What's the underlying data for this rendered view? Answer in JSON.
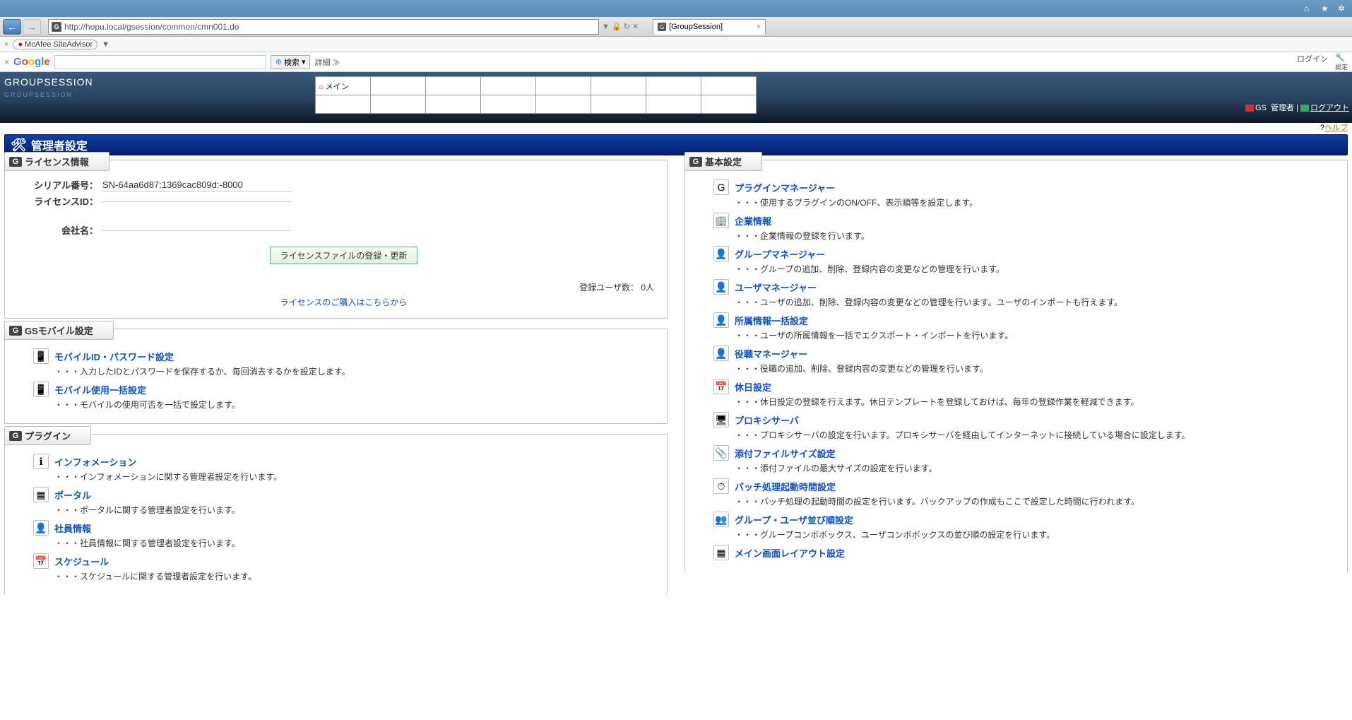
{
  "browser": {
    "url": "http://hopu.local/gsession/common/cmn001.do",
    "url_actions": "▼   🔒 ↻ ✕",
    "tab_title": "[GroupSession]",
    "tab_close": "×",
    "titlebar_home": "⌂",
    "titlebar_star": "★",
    "titlebar_gear": "✲"
  },
  "mcafee": {
    "label": "McAfee SiteAdvisor",
    "close": "×",
    "arrow": "▼"
  },
  "google": {
    "close": "×",
    "search_btn": "検索",
    "search_arrow": "▾",
    "detail": "詳細 ≫",
    "login": "ログイン",
    "settings": "設定"
  },
  "gs_header": {
    "brand": "GROUPSESSION",
    "brand_sub": "GROUPSESSION",
    "menu_main": "メイン",
    "info_gs": "GS",
    "info_admin": "管理者",
    "logout": "ログアウト",
    "help": "ヘルプ"
  },
  "admin_title": "管理者設定",
  "license_panel": {
    "title": "ライセンス情報",
    "serial_k": "シリアル番号：",
    "serial_v": "SN-64aa6d87:1369cac809d:-8000",
    "id_k": "ライセンスID：",
    "id_v": "",
    "company_k": "会社名：",
    "company_v": "",
    "btn": "ライセンスファイルの登録・更新",
    "users": "登録ユーザ数： 0人",
    "buy_link": "ライセンスのご購入はこちらから"
  },
  "mobile_panel": {
    "title": "GSモバイル設定",
    "items": [
      {
        "icon": "📱",
        "name": "mobile-id-password",
        "label": "モバイルID・パスワード設定",
        "desc": "・・・入力したIDとパスワードを保存するか、毎回消去するかを設定します。"
      },
      {
        "icon": "📱",
        "name": "mobile-use-batch",
        "label": "モバイル使用一括設定",
        "desc": "・・・モバイルの使用可否を一括で設定します。"
      }
    ]
  },
  "plugin_panel": {
    "title": "プラグイン",
    "items": [
      {
        "icon": "ℹ",
        "name": "information",
        "label": "インフォメーション",
        "desc": "・・・インフォメーションに関する管理者設定を行います。"
      },
      {
        "icon": "▦",
        "name": "portal",
        "label": "ポータル",
        "desc": "・・・ポータルに関する管理者設定を行います。"
      },
      {
        "icon": "👤",
        "name": "shain-info",
        "label": "社員情報",
        "desc": "・・・社員情報に関する管理者設定を行います。"
      },
      {
        "icon": "📅",
        "name": "schedule",
        "label": "スケジュール",
        "desc": "・・・スケジュールに関する管理者設定を行います。"
      }
    ]
  },
  "basic_panel": {
    "title": "基本設定",
    "items": [
      {
        "icon": "G",
        "name": "plugin-manager",
        "label": "プラグインマネージャー",
        "desc": "・・・使用するプラグインのON/OFF、表示順等を設定します。"
      },
      {
        "icon": "🏢",
        "name": "company-info",
        "label": "企業情報",
        "desc": "・・・企業情報の登録を行います。"
      },
      {
        "icon": "👤",
        "name": "group-manager",
        "label": "グループマネージャー",
        "desc": "・・・グループの追加、削除、登録内容の変更などの管理を行います。"
      },
      {
        "icon": "👤",
        "name": "user-manager",
        "label": "ユーザマネージャー",
        "desc": "・・・ユーザの追加、削除、登録内容の変更などの管理を行います。ユーザのインポートも行えます。"
      },
      {
        "icon": "👤",
        "name": "belong-batch",
        "label": "所属情報一括設定",
        "desc": "・・・ユーザの所属情報を一括でエクスポート・インポートを行います。"
      },
      {
        "icon": "👤",
        "name": "role-manager",
        "label": "役職マネージャー",
        "desc": "・・・役職の追加、削除、登録内容の変更などの管理を行います。"
      },
      {
        "icon": "📅",
        "name": "holiday",
        "label": "休日設定",
        "desc": "・・・休日設定の登録を行えます。休日テンプレートを登録しておけば、毎年の登録作業を軽減できます。"
      },
      {
        "icon": "🖥",
        "name": "proxy",
        "label": "プロキシサーバ",
        "desc": "・・・プロキシサーバの設定を行います。プロキシサーバを経由してインターネットに接続している場合に設定します。"
      },
      {
        "icon": "📎",
        "name": "attachment-size",
        "label": "添付ファイルサイズ設定",
        "desc": "・・・添付ファイルの最大サイズの設定を行います。"
      },
      {
        "icon": "⏱",
        "name": "batch-time",
        "label": "バッチ処理起動時間設定",
        "desc": "・・・バッチ処理の起動時間の設定を行います。バックアップの作成もここで設定した時間に行われます。"
      },
      {
        "icon": "👥",
        "name": "group-user-order",
        "label": "グループ・ユーザ並び順設定",
        "desc": "・・・グループコンボボックス、ユーザコンボボックスの並び順の設定を行います。"
      },
      {
        "icon": "▦",
        "name": "main-layout",
        "label": "メイン画面レイアウト設定",
        "desc": ""
      }
    ]
  }
}
